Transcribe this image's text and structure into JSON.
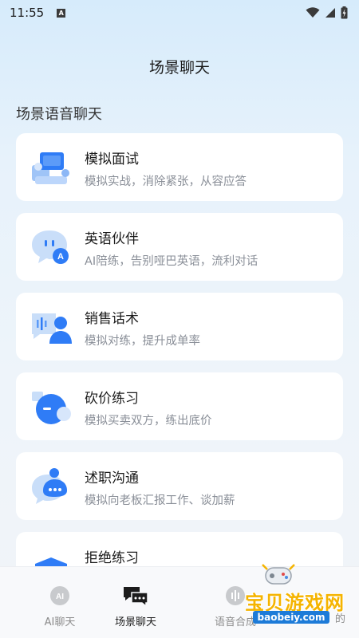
{
  "status_bar": {
    "time": "11:55",
    "indicator": "A"
  },
  "header": {
    "title": "场景聊天"
  },
  "section": {
    "title": "场景语音聊天"
  },
  "cards": [
    {
      "title": "模拟面试",
      "subtitle": "模拟实战，消除紧张，从容应答",
      "icon": "interview-icon"
    },
    {
      "title": "英语伙伴",
      "subtitle": "AI陪练，告别哑巴英语，流利对话",
      "icon": "english-partner-icon"
    },
    {
      "title": "销售话术",
      "subtitle": "模拟对练，提升成单率",
      "icon": "sales-script-icon"
    },
    {
      "title": "砍价练习",
      "subtitle": "模拟买卖双方，练出底价",
      "icon": "bargain-icon"
    },
    {
      "title": "述职沟通",
      "subtitle": "模拟向老板汇报工作、谈加薪",
      "icon": "report-icon"
    },
    {
      "title": "拒绝练习",
      "subtitle": "",
      "icon": "refuse-icon"
    }
  ],
  "bottom_nav": [
    {
      "label": "AI聊天",
      "icon": "ai-chat-icon",
      "active": false
    },
    {
      "label": "场景聊天",
      "icon": "scene-chat-icon",
      "active": true
    },
    {
      "label": "语音合成",
      "icon": "voice-synth-icon",
      "active": false
    }
  ],
  "watermark": {
    "text": "宝贝游戏网",
    "url": "baobeiy.com",
    "partial_text": "的"
  },
  "colors": {
    "accent_blue": "#2f7cf6",
    "card_bg": "#ffffff",
    "subtitle": "#8a8f98",
    "watermark": "#f5b400"
  }
}
